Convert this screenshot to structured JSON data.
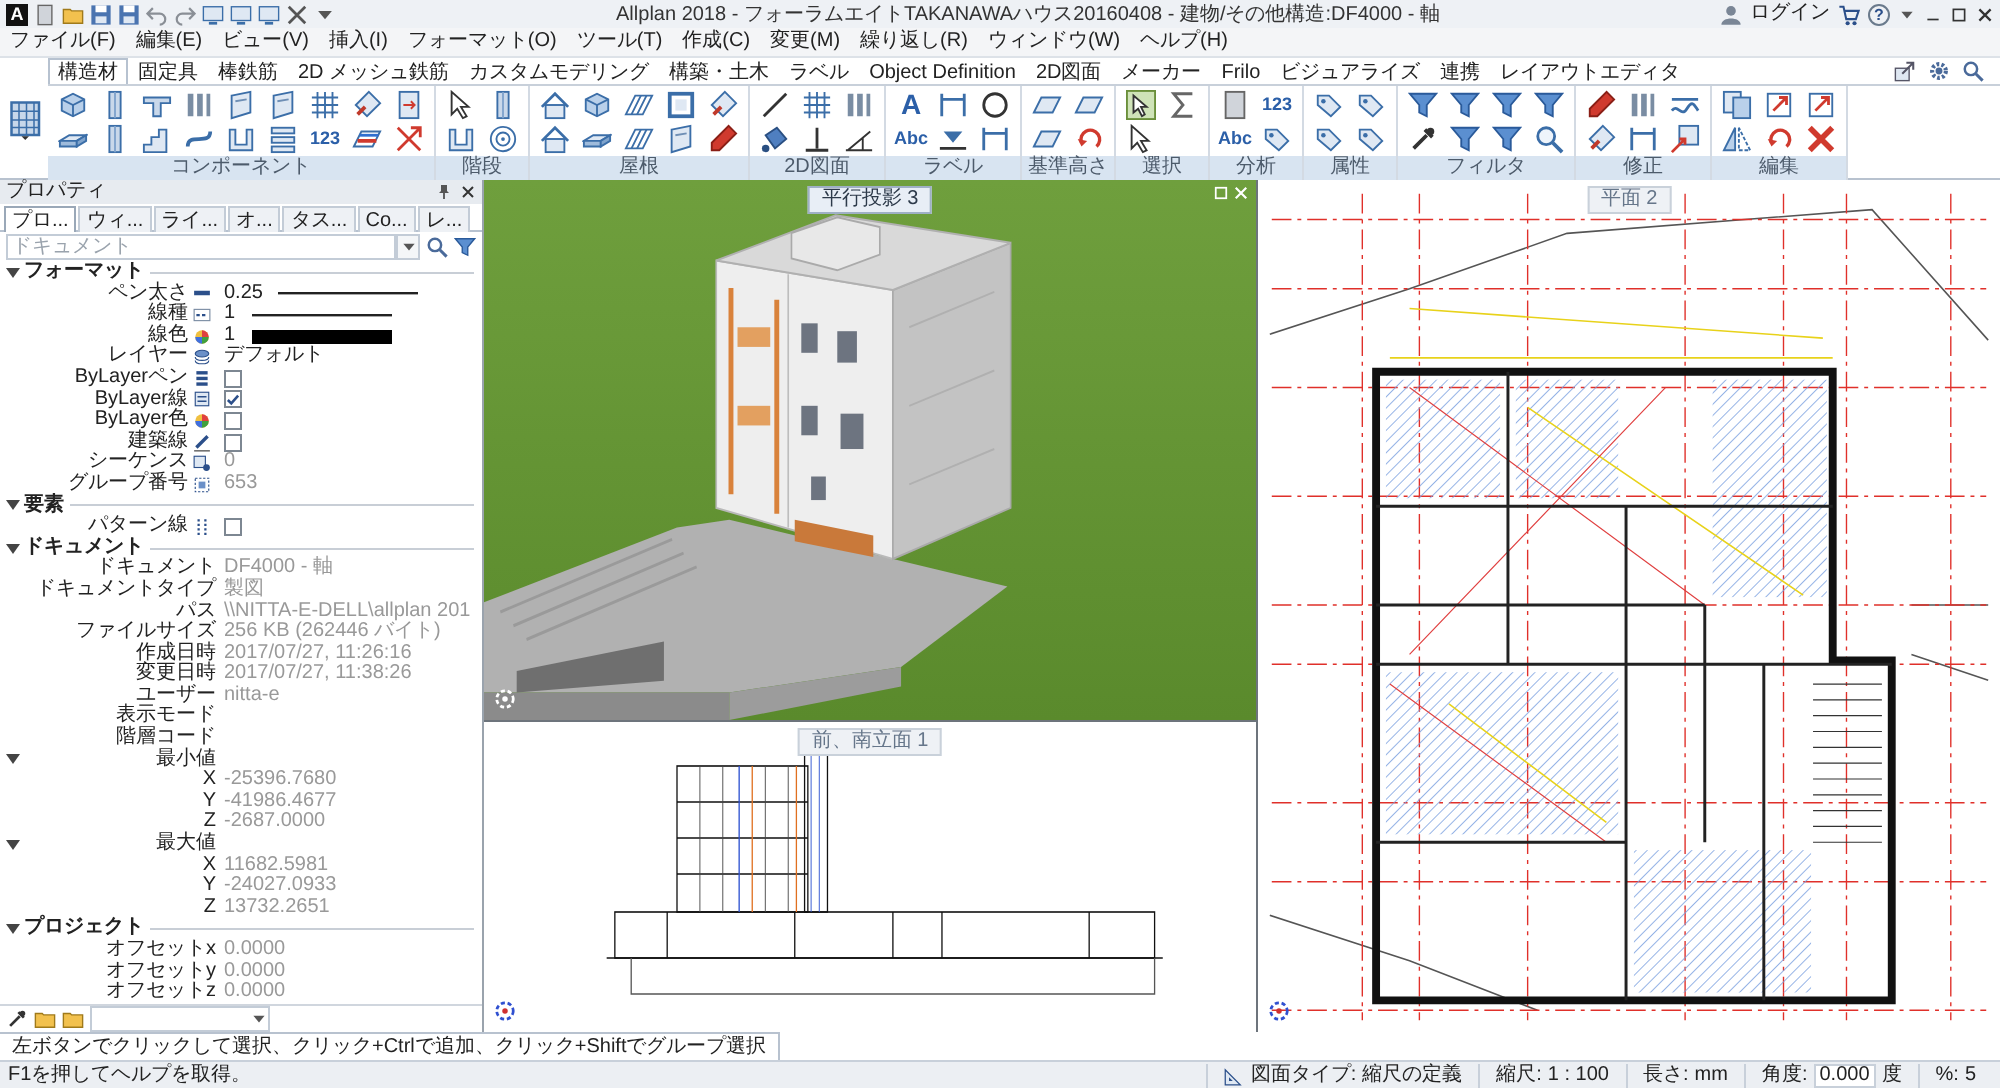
{
  "window": {
    "logo": "A",
    "title": "Allplan 2018 - フォーラムエイトTAKANAWAハウス20160408 - 建物/その他構造:DF4000 - 軸",
    "login": "ログイン",
    "help": "?"
  },
  "menu": [
    "ファイル(F)",
    "編集(E)",
    "ビュー(V)",
    "挿入(I)",
    "フォーマット(O)",
    "ツール(T)",
    "作成(C)",
    "変更(M)",
    "繰り返し(R)",
    "ウィンドウ(W)",
    "ヘルプ(H)"
  ],
  "ribbon": {
    "tabs": [
      {
        "label": "構造材",
        "selected": true
      },
      {
        "label": "固定具",
        "selected": false
      },
      {
        "label": "棒鉄筋",
        "selected": false
      },
      {
        "label": "2D メッシュ鉄筋",
        "selected": false
      },
      {
        "label": "カスタムモデリング",
        "selected": false
      },
      {
        "label": "構築・土木",
        "selected": false
      },
      {
        "label": "ラベル",
        "selected": false
      },
      {
        "label": "Object Definition",
        "selected": false
      },
      {
        "label": "2D図面",
        "selected": false
      },
      {
        "label": "メーカー",
        "selected": false
      },
      {
        "label": "Frilo",
        "selected": false
      },
      {
        "label": "ビジュアライズ",
        "selected": false
      },
      {
        "label": "連携",
        "selected": false
      },
      {
        "label": "レイアウトエディタ",
        "selected": false
      }
    ],
    "groups": [
      {
        "label": "コンポーネント",
        "text_tools": [
          "123"
        ]
      },
      {
        "label": "階段"
      },
      {
        "label": "屋根"
      },
      {
        "label": "2D図面"
      },
      {
        "label": "ラベル",
        "text_tools": [
          "A",
          "Abc"
        ]
      },
      {
        "label": "基準高さ"
      },
      {
        "label": "選択"
      },
      {
        "label": "分析",
        "text_tools": [
          "123",
          "Abc"
        ]
      },
      {
        "label": "属性"
      },
      {
        "label": "フィルタ"
      },
      {
        "label": "修正"
      },
      {
        "label": "編集"
      }
    ]
  },
  "properties": {
    "title": "プロパティ",
    "tabs": [
      {
        "label": "プロ...",
        "selected": true
      },
      {
        "label": "ウィ...",
        "selected": false
      },
      {
        "label": "ライ...",
        "selected": false
      },
      {
        "label": "オ...",
        "selected": false
      },
      {
        "label": "タス...",
        "selected": false
      },
      {
        "label": "Co...",
        "selected": false
      },
      {
        "label": "レ...",
        "selected": false
      }
    ],
    "filter": {
      "placeholder": "ドキュメント"
    },
    "sections": [
      {
        "title": "フォーマット",
        "expanded": true,
        "rows": [
          {
            "kind": "line",
            "label": "ペン太さ",
            "value": "0.25",
            "disabled": false
          },
          {
            "kind": "line",
            "label": "線種",
            "value": "1",
            "disabled": false
          },
          {
            "kind": "swatch",
            "label": "線色",
            "value": "1",
            "color": "#000000",
            "disabled": false
          },
          {
            "kind": "text",
            "label": "レイヤー",
            "value": "デフォルト",
            "disabled": false
          },
          {
            "kind": "checkbox",
            "label": "ByLayerペン",
            "checked": false
          },
          {
            "kind": "checkbox",
            "label": "ByLayer線",
            "checked": true
          },
          {
            "kind": "checkbox",
            "label": "ByLayer色",
            "checked": false
          },
          {
            "kind": "checkbox",
            "label": "建築線",
            "checked": false
          },
          {
            "kind": "text",
            "label": "シーケンス",
            "value": "0",
            "disabled": true
          },
          {
            "kind": "text",
            "label": "グループ番号",
            "value": "653",
            "disabled": true
          }
        ]
      },
      {
        "title": "要素",
        "expanded": true,
        "rows": [
          {
            "kind": "checkbox",
            "label": "パターン線",
            "checked": false
          }
        ]
      },
      {
        "title": "ドキュメント",
        "expanded": true,
        "rows": [
          {
            "kind": "text",
            "label": "ドキュメント",
            "value": "DF4000 - 軸",
            "disabled": true
          },
          {
            "kind": "text",
            "label": "ドキュメントタイプ",
            "value": "製図",
            "disabled": true
          },
          {
            "kind": "text",
            "label": "パス",
            "value": "\\\\NITTA-E-DELL\\allplan 201",
            "disabled": true
          },
          {
            "kind": "text",
            "label": "ファイルサイズ",
            "value": "256 KB (262446 バイト)",
            "disabled": true
          },
          {
            "kind": "text",
            "label": "作成日時",
            "value": "2017/07/27, 11:26:16",
            "disabled": true
          },
          {
            "kind": "text",
            "label": "変更日時",
            "value": "2017/07/27, 11:38:26",
            "disabled": true
          },
          {
            "kind": "text",
            "label": "ユーザー",
            "value": "nitta-e",
            "disabled": true
          },
          {
            "kind": "label",
            "label": "表示モード"
          },
          {
            "kind": "label",
            "label": "階層コード"
          },
          {
            "kind": "group",
            "label": "最小値",
            "expanded": true,
            "children": [
              {
                "kind": "text",
                "label": "X",
                "value": "-25396.7680",
                "disabled": true
              },
              {
                "kind": "text",
                "label": "Y",
                "value": "-41986.4677",
                "disabled": true
              },
              {
                "kind": "text",
                "label": "Z",
                "value": "-2687.0000",
                "disabled": true
              }
            ]
          },
          {
            "kind": "group",
            "label": "最大値",
            "expanded": true,
            "children": [
              {
                "kind": "text",
                "label": "X",
                "value": "11682.5981",
                "disabled": true
              },
              {
                "kind": "text",
                "label": "Y",
                "value": "-24027.0933",
                "disabled": true
              },
              {
                "kind": "text",
                "label": "Z",
                "value": "13732.2651",
                "disabled": true
              }
            ]
          }
        ]
      },
      {
        "title": "プロジェクト",
        "expanded": true,
        "rows": [
          {
            "kind": "text",
            "label": "オフセットx",
            "value": "0.0000",
            "disabled": true
          },
          {
            "kind": "text",
            "label": "オフセットy",
            "value": "0.0000",
            "disabled": true
          },
          {
            "kind": "text",
            "label": "オフセットz",
            "value": "0.0000",
            "disabled": true
          }
        ]
      }
    ]
  },
  "viewports": [
    {
      "kind": "model",
      "title": "平行投影 3"
    },
    {
      "kind": "plan",
      "title": "平面 2"
    },
    {
      "kind": "elevation",
      "title": "前、南立面 1"
    }
  ],
  "command_hint": "左ボタンでクリックして選択、クリック+Ctrlで追加、クリック+Shiftでグループ選択",
  "status_bar": {
    "help": "F1を押してヘルプを取得。",
    "fields": [
      {
        "kind": "icon_text",
        "label": "図面タイプ:",
        "value": "縮尺の定義"
      },
      {
        "kind": "text",
        "label": "縮尺:",
        "value": "1 : 100"
      },
      {
        "kind": "text",
        "label": "長さ:",
        "value": "mm"
      },
      {
        "kind": "field",
        "label": "角度:",
        "value": "0.000",
        "unit": "度"
      },
      {
        "kind": "text",
        "label": "%:",
        "value": "5"
      }
    ]
  }
}
